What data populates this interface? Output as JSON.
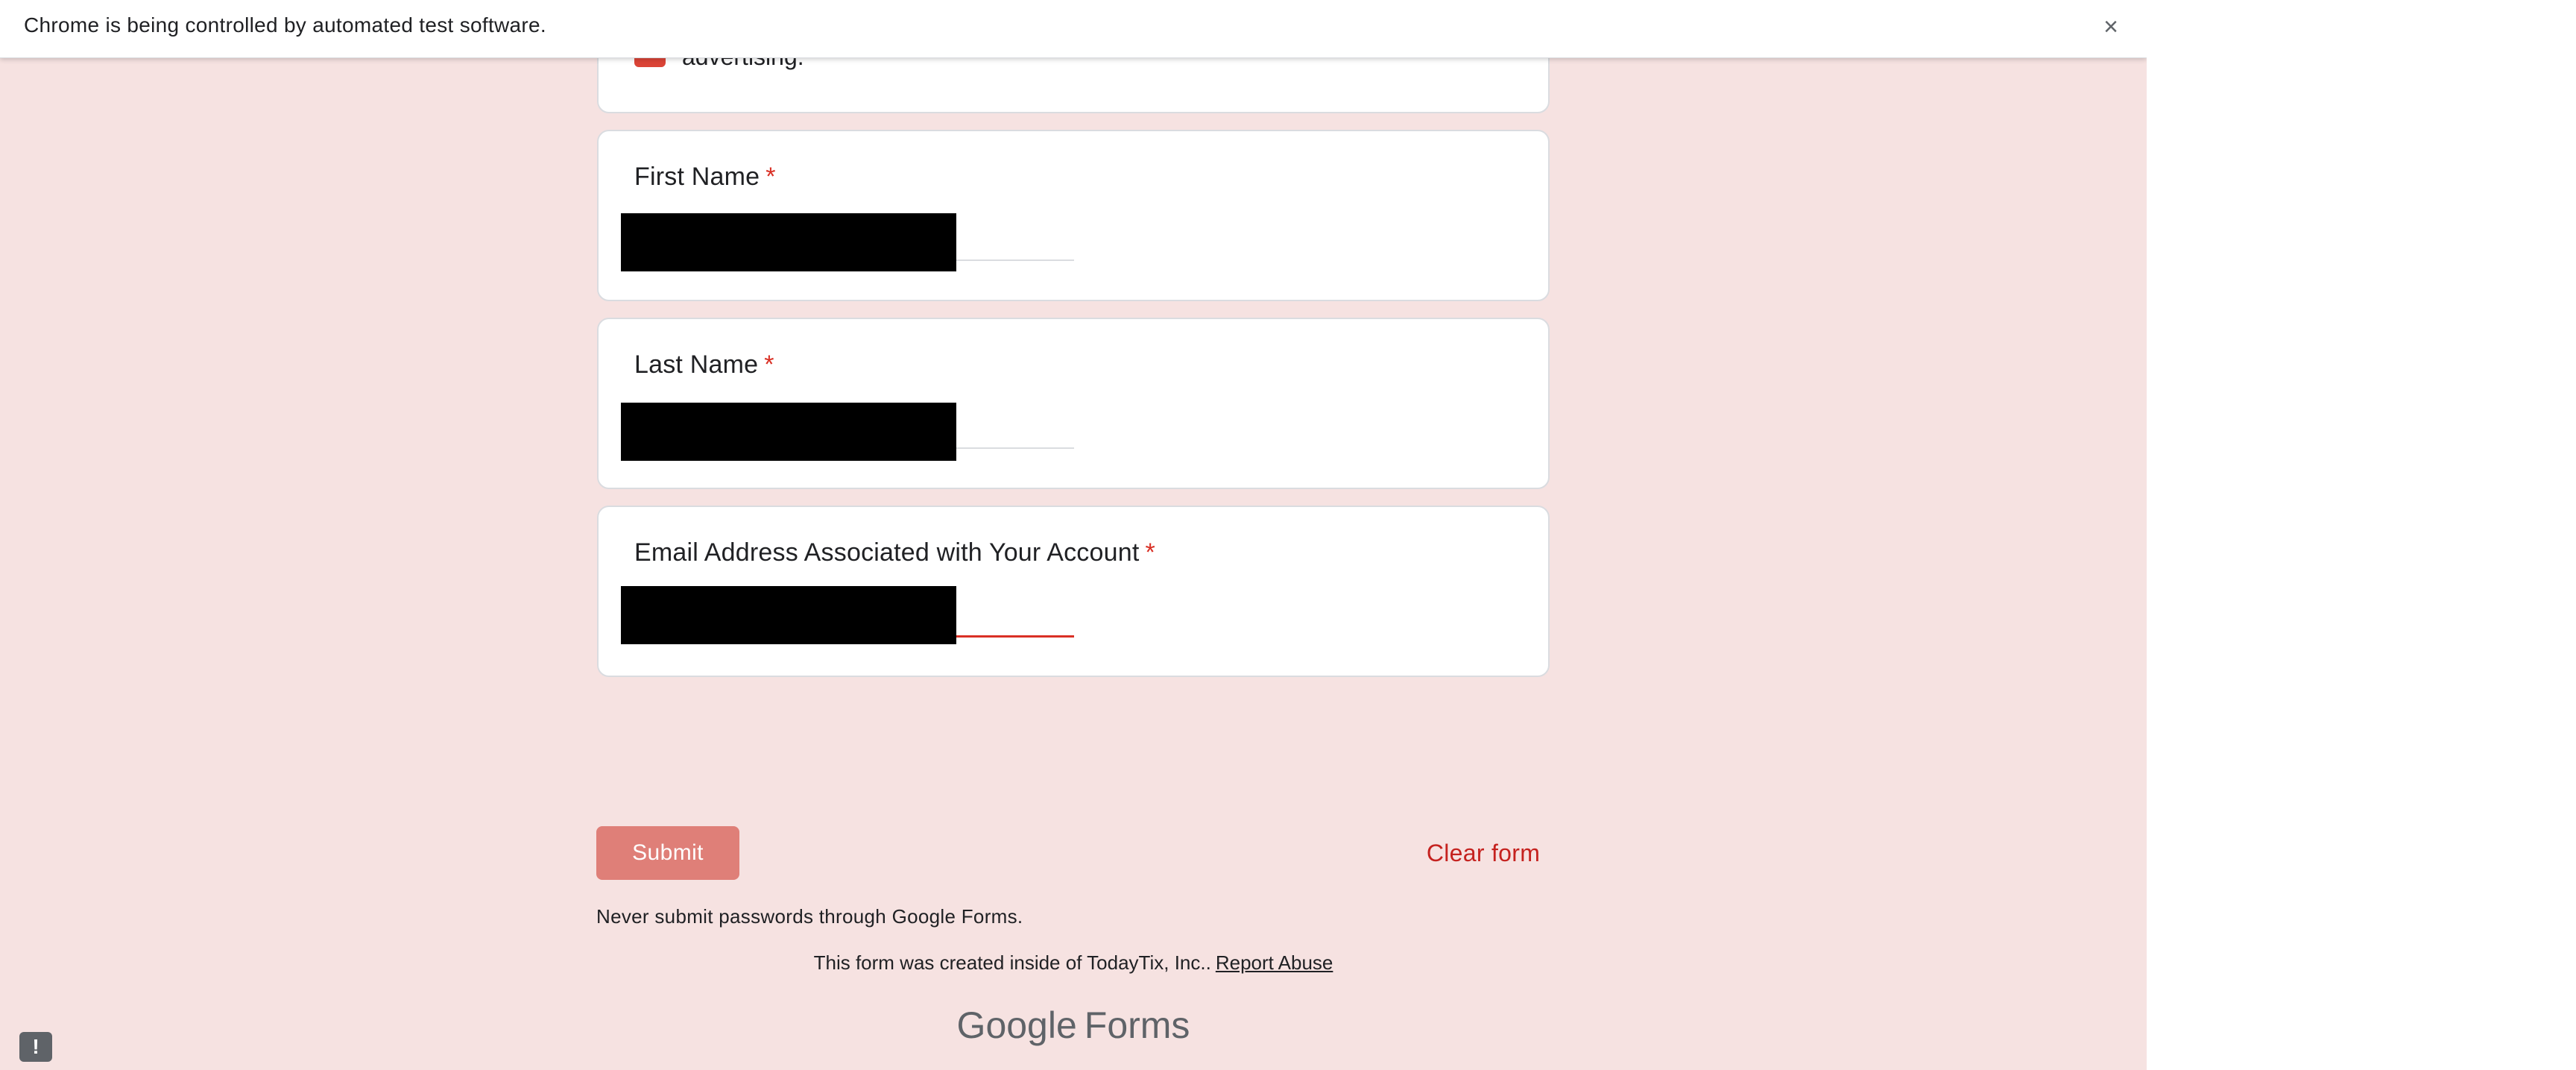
{
  "infobar": {
    "message": "Chrome is being controlled by automated test software.",
    "close_icon": "×"
  },
  "consent": {
    "text": "advertising.",
    "checked": true
  },
  "questions": [
    {
      "title": "First Name",
      "required_mark": "*"
    },
    {
      "title": "Last Name",
      "required_mark": "*"
    },
    {
      "title": "Email Address Associated with Your Account",
      "required_mark": "*"
    }
  ],
  "actions": {
    "submit_label": "Submit",
    "clear_label": "Clear form"
  },
  "notice": "Never submit passwords through Google Forms.",
  "footer": {
    "text": "This form was created inside of TodayTix, Inc..",
    "report_link": "Report Abuse"
  },
  "logo": {
    "google": "Google",
    "forms": "Forms"
  },
  "feedback_icon": "!",
  "colors": {
    "page_bg": "#f6e2e1",
    "accent": "#db4437",
    "submit_bg": "#df7f78",
    "required": "#d93025"
  }
}
